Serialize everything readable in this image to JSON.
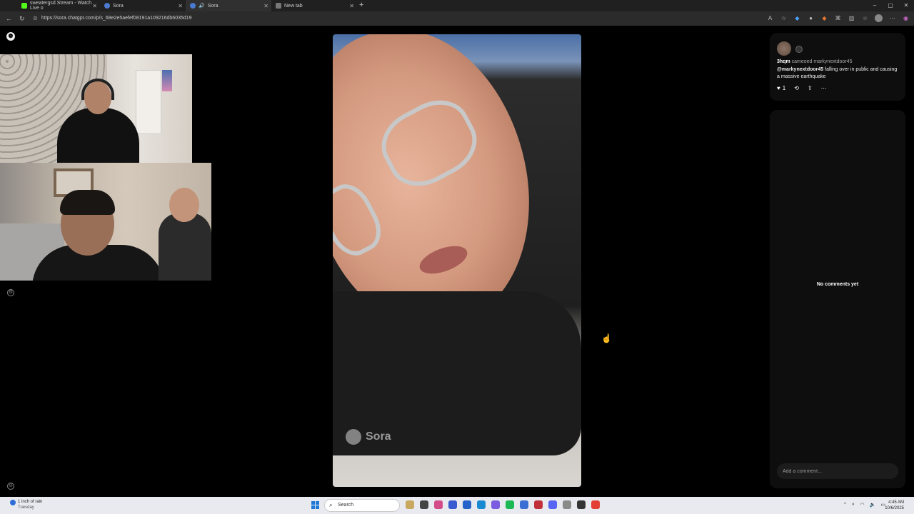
{
  "browser": {
    "tabs": [
      {
        "label": "sweatergsd Stream - Watch Live o",
        "favicon_color": "#53fc18",
        "active": false
      },
      {
        "label": "Sora",
        "favicon_color": "#4a7bd0",
        "active": false
      },
      {
        "label": "Sora",
        "favicon_color": "#4a7bd0",
        "active": true
      },
      {
        "label": "New tab",
        "favicon_color": "#777777",
        "active": false
      }
    ],
    "new_tab_label": "+",
    "url": "https://sora.chatgpt.com/p/s_68e2e5aefef08191a109216db6035d19",
    "window_controls": [
      "–",
      "▢",
      "✕"
    ]
  },
  "page": {
    "logo": "❁",
    "video_watermark": "Sora",
    "post": {
      "username": "3hqm",
      "action_text": "cameoed",
      "cameo_user": "markynextdoor45",
      "mention": "@markynextdoor45",
      "caption": "falling over in public and causing a massive earthquake",
      "like_count": "1",
      "icons": [
        "heart-icon",
        "remix-icon",
        "share-icon",
        "more-icon"
      ]
    },
    "comments": {
      "empty_text": "No comments yet",
      "input_placeholder": "Add a comment..."
    }
  },
  "taskbar": {
    "weather_text": "1 inch of rain",
    "weather_day": "Tuesday",
    "search_label": "Search",
    "time": "4:45 AM",
    "date": "10/6/2025",
    "app_colors": [
      "#c9a860",
      "#444444",
      "#d44b8a",
      "#3a5bd0",
      "#2663c9",
      "#1a8ad0",
      "#7b5be0",
      "#1db954",
      "#3b6fd3",
      "#c0303a",
      "#5865f2",
      "#8a8a8a",
      "#333333",
      "#e34033"
    ]
  }
}
